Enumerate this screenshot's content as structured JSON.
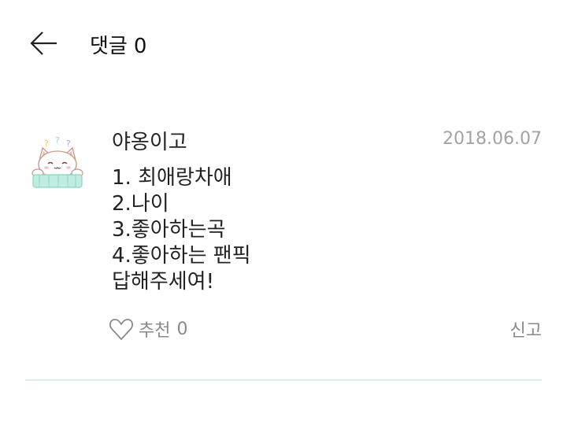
{
  "header": {
    "title": "댓글",
    "count": "0",
    "back_icon": "arrow-left-icon"
  },
  "comment": {
    "author": "야옹이고",
    "date": "2018.06.07",
    "avatar_icon": "cat-avatar-icon",
    "lines": [
      "1. 최애랑차애",
      "2.나이",
      "3.좋아하는곡",
      "4.좋아하는 팬픽",
      "답해주세여!"
    ],
    "like_label": "추천",
    "like_count": "0",
    "like_icon": "heart-outline-icon",
    "report_label": "신고"
  },
  "colors": {
    "text": "#222222",
    "muted": "#8a8a8a",
    "date": "#a3a3a3",
    "divider": "#dfe9ee"
  }
}
